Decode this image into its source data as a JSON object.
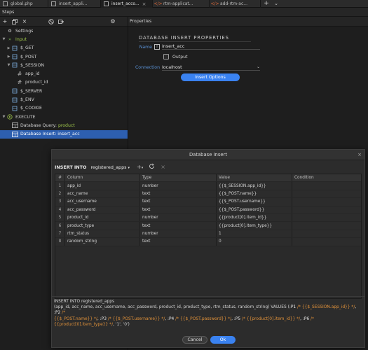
{
  "tabs": [
    {
      "label": "global.php",
      "icon": "php-file-icon"
    },
    {
      "label": "insert_appli...",
      "icon": "php-file-icon"
    },
    {
      "label": "insert_acco...",
      "icon": "php-file-icon",
      "active": true
    },
    {
      "label": "rtm-applicat...",
      "icon": "code-icon"
    },
    {
      "label": "add-rtm-ac...",
      "icon": "code-icon"
    }
  ],
  "steps_label": "Steps",
  "properties_label": "Properties",
  "tree": [
    {
      "label": "Settings",
      "icon": "gear-icon",
      "indent": 0,
      "arrow": ""
    },
    {
      "label": "Input",
      "icon": "chevron-right-icon",
      "indent": 0,
      "arrow": "v",
      "green": true
    },
    {
      "label": "$_GET",
      "icon": "db-icon",
      "indent": 1,
      "arrow": ">"
    },
    {
      "label": "$_POST",
      "icon": "db-icon",
      "indent": 1,
      "arrow": ">"
    },
    {
      "label": "$_SESSION",
      "icon": "db-icon",
      "indent": 1,
      "arrow": "v"
    },
    {
      "label": "app_id",
      "icon": "hash-icon",
      "indent": 2,
      "arrow": ""
    },
    {
      "label": "product_id",
      "icon": "hash-icon",
      "indent": 2,
      "arrow": ""
    },
    {
      "label": "$_SERVER",
      "icon": "db-icon",
      "indent": 1,
      "arrow": ""
    },
    {
      "label": "$_ENV",
      "icon": "db-icon",
      "indent": 1,
      "arrow": ""
    },
    {
      "label": "$_COOKIE",
      "icon": "db-icon",
      "indent": 1,
      "arrow": ""
    },
    {
      "label": "EXECUTE",
      "icon": "execute-icon",
      "indent": 0,
      "arrow": "v"
    },
    {
      "label": "Database Query: ",
      "label2": "product",
      "icon": "table-icon",
      "indent": 1,
      "arrow": ""
    },
    {
      "label": "Database Insert: insert_acc",
      "icon": "table-icon",
      "indent": 1,
      "arrow": "",
      "selected": true
    }
  ],
  "properties": {
    "section_title": "DATABASE INSERT PROPERTIES",
    "name_label": "Name",
    "name_value": "insert_acc",
    "output_label": "Output",
    "connection_label": "Connection",
    "connection_value": "localhost",
    "insert_options_label": "Insert Options"
  },
  "dialog": {
    "title": "Database Insert",
    "insert_into_label": "INSERT INTO",
    "table_value": "registered_apps",
    "columns_header": [
      "#",
      "Column",
      "Type",
      "Value",
      "Condition"
    ],
    "rows": [
      {
        "n": "1",
        "column": "app_id",
        "type": "number",
        "value": "{{$_SESSION.app_id}}",
        "condition": ""
      },
      {
        "n": "2",
        "column": "acc_name",
        "type": "text",
        "value": "{{$_POST.name}}",
        "condition": ""
      },
      {
        "n": "3",
        "column": "acc_username",
        "type": "text",
        "value": "{{$_POST.username}}",
        "condition": ""
      },
      {
        "n": "4",
        "column": "acc_password",
        "type": "text",
        "value": "{{$_POST.password}}",
        "condition": ""
      },
      {
        "n": "5",
        "column": "product_id",
        "type": "number",
        "value": "{{product[0].item_id}}",
        "condition": ""
      },
      {
        "n": "6",
        "column": "product_type",
        "type": "text",
        "value": "{{product[0].item_type}}",
        "condition": ""
      },
      {
        "n": "7",
        "column": "rtm_status",
        "type": "number",
        "value": "1",
        "condition": ""
      },
      {
        "n": "8",
        "column": "random_string",
        "type": "text",
        "value": "0",
        "condition": ""
      }
    ],
    "sql_line1": "INSERT INTO registered_apps",
    "sql_line2_a": "(app_id, acc_name, acc_username, acc_password, product_id, product_type, rtm_status, random_string) VALUES (",
    "sql_p1": ":P1",
    "sql_c1": " /* {{$_SESSION.app_id}} */",
    "sql_p2": ", :P2",
    "sql_c2": " /*",
    "sql_line3_c2": "{{$_POST.name}} */",
    "sql_p3": ", :P3",
    "sql_c3": " /* {{$_POST.username}} */",
    "sql_p4": ", :P4",
    "sql_c4": " /* {{$_POST.password}} */",
    "sql_p5": ", :P5",
    "sql_c5": " /* {{product[0].item_id}} */",
    "sql_p6": ", :P6",
    "sql_c6": " /* {{product[0].item_type}} */",
    "sql_tail": ", '1', '0')",
    "cancel_label": "Cancel",
    "ok_label": "Ok"
  },
  "colors": {
    "accent": "#3a82f0",
    "selected_row": "#2d5fb0",
    "label_blue": "#5b93d8",
    "sql_comment": "#e0913a",
    "tree_green": "#9fc64a"
  }
}
